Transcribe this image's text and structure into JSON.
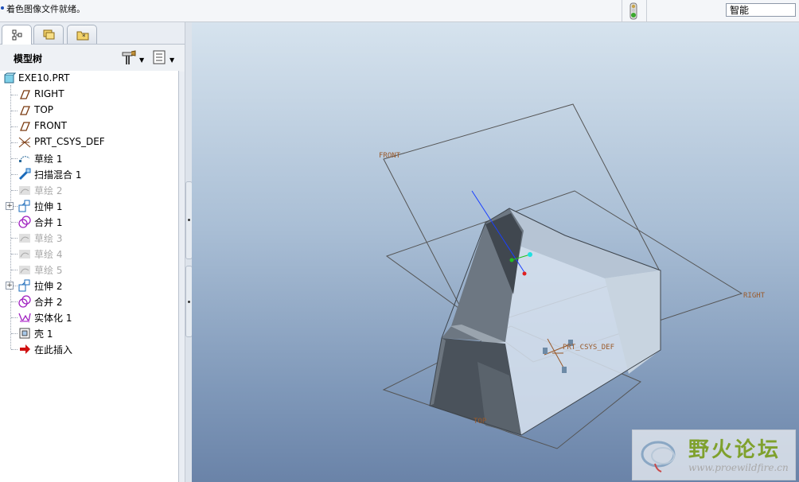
{
  "status": {
    "message": "着色图像文件就绪。",
    "filter_value": "智能"
  },
  "panel": {
    "tabs": [
      {
        "name": "model-tree",
        "icon": "model-tree-icon",
        "active": true
      },
      {
        "name": "folder-browser",
        "icon": "folder-browser-icon",
        "active": false
      },
      {
        "name": "favorites",
        "icon": "favorites-icon",
        "active": false
      }
    ],
    "tree_title": "模型树"
  },
  "tree": {
    "items": [
      {
        "label": "EXE10.PRT",
        "icon": "part-icon",
        "enabled": true,
        "expandable": false,
        "root": true
      },
      {
        "label": "RIGHT",
        "icon": "datum-plane-icon",
        "enabled": true,
        "expandable": false
      },
      {
        "label": "TOP",
        "icon": "datum-plane-icon",
        "enabled": true,
        "expandable": false
      },
      {
        "label": "FRONT",
        "icon": "datum-plane-icon",
        "enabled": true,
        "expandable": false
      },
      {
        "label": "PRT_CSYS_DEF",
        "icon": "csys-icon",
        "enabled": true,
        "expandable": false
      },
      {
        "label": "草绘 1",
        "icon": "sketch-icon",
        "enabled": true,
        "expandable": false
      },
      {
        "label": "扫描混合 1",
        "icon": "swept-blend-icon",
        "enabled": true,
        "expandable": false
      },
      {
        "label": "草绘 2",
        "icon": "sketch-icon",
        "enabled": false,
        "expandable": false
      },
      {
        "label": "拉伸 1",
        "icon": "extrude-icon",
        "enabled": true,
        "expandable": true
      },
      {
        "label": "合并 1",
        "icon": "merge-icon",
        "enabled": true,
        "expandable": false
      },
      {
        "label": "草绘 3",
        "icon": "sketch-icon",
        "enabled": false,
        "expandable": false
      },
      {
        "label": "草绘 4",
        "icon": "sketch-icon",
        "enabled": false,
        "expandable": false
      },
      {
        "label": "草绘 5",
        "icon": "sketch-icon",
        "enabled": false,
        "expandable": false
      },
      {
        "label": "拉伸 2",
        "icon": "extrude-icon",
        "enabled": true,
        "expandable": true
      },
      {
        "label": "合并 2",
        "icon": "merge-icon",
        "enabled": true,
        "expandable": false
      },
      {
        "label": "实体化 1",
        "icon": "solidify-icon",
        "enabled": true,
        "expandable": false
      },
      {
        "label": "壳 1",
        "icon": "shell-icon",
        "enabled": true,
        "expandable": false
      },
      {
        "label": "在此插入",
        "icon": "insert-here-arrow-icon",
        "enabled": true,
        "expandable": false
      }
    ]
  },
  "viewport": {
    "datum_labels": {
      "front": "FRONT",
      "right": "RIGHT",
      "top": "TOP",
      "csys": "PRT_CSYS_DEF"
    }
  },
  "watermark": {
    "title": "野火论坛",
    "url": "www.proewildfire.cn"
  },
  "colors": {
    "status_light": "#3aa82c",
    "datum_label": "#9a5a2a",
    "axis_blue": "#1a40ff",
    "axis_red": "#e02020",
    "axis_green": "#20c020",
    "axis_cyan": "#20e0e0",
    "watermark_green": "#7fa12d"
  }
}
